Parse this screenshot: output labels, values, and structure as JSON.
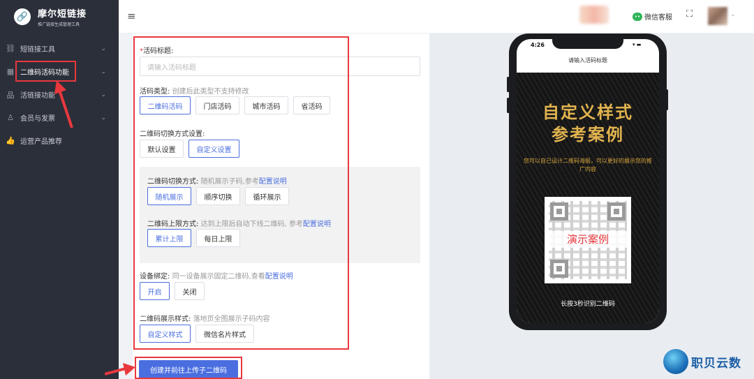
{
  "app": {
    "logo_glyph": "🔗",
    "title": "摩尔短链接",
    "subtitle": "推广链接生成管理工具"
  },
  "sidebar": {
    "items": [
      {
        "label": "短链接工具",
        "icon": "link-icon",
        "glyph": "⛓",
        "chevron": "⌄"
      },
      {
        "label": "二维码活码功能",
        "icon": "qr-code-icon",
        "glyph": "▦",
        "chevron": "⌄"
      },
      {
        "label": "活链接功能",
        "icon": "sitemap-icon",
        "glyph": "品",
        "chevron": "⌄"
      },
      {
        "label": "会员与发票",
        "icon": "user-icon",
        "glyph": "♙",
        "chevron": "⌄"
      },
      {
        "label": "运营产品推荐",
        "icon": "thumbs-up-icon",
        "glyph": "👍",
        "chevron": ""
      }
    ]
  },
  "header": {
    "menu_glyph": "≡",
    "wechat_label": "微信客服",
    "wechat_glyph": "••",
    "fullscreen_glyph": "⛶",
    "user_caret": "⌄"
  },
  "form": {
    "title_field": {
      "required_mark": "*",
      "label": "活码标题:",
      "placeholder": "请输入活码标题"
    },
    "type_field": {
      "label": "活码类型:",
      "hint": "创建后此类型不支持修改",
      "options": [
        "二维码活码",
        "门店活码",
        "城市活码",
        "省活码"
      ],
      "selected": 0
    },
    "switch_setting": {
      "label": "二维码切换方式设置:",
      "options": [
        "默认设置",
        "自定义设置"
      ],
      "selected": 1
    },
    "switch_mode": {
      "label": "二维码切换方式:",
      "hint": "随机展示子码,参考",
      "link": "配置说明",
      "options": [
        "随机展示",
        "顺序切换",
        "循环展示"
      ],
      "selected": 0
    },
    "limit_mode": {
      "label": "二维码上限方式:",
      "hint": "达到上限后自动下线二维码, 参考",
      "link": "配置说明",
      "options": [
        "累计上限",
        "每日上限"
      ],
      "selected": 0
    },
    "device_bind": {
      "label": "设备绑定:",
      "hint": "同一设备展示固定二维码,查看",
      "link": "配置说明",
      "options": [
        "开启",
        "关闭"
      ],
      "selected": 0
    },
    "display_style": {
      "label": "二维码展示样式:",
      "hint": "落地页全图展示子码内容",
      "options": [
        "自定义样式",
        "微信名片样式"
      ],
      "selected": 0
    },
    "submit_label": "创建并前往上传子二维码"
  },
  "preview": {
    "time": "4:26",
    "status_icons": "▾ ▬",
    "page_title": "请输入活码标题",
    "headline_1": "自定义样式",
    "headline_2": "参考案例",
    "description": "您可以自己设计二维码海报，可以更好的展示您的推广内容",
    "qr_overlay": "演示案例",
    "footer": "长按3秒识别二维码"
  },
  "watermark": {
    "text": "职贝云数"
  },
  "colors": {
    "accent": "#4a6ee0",
    "highlight": "#e8383d",
    "sidebar_bg": "#2b2f3a",
    "poster_gold": "#e2b44f"
  }
}
